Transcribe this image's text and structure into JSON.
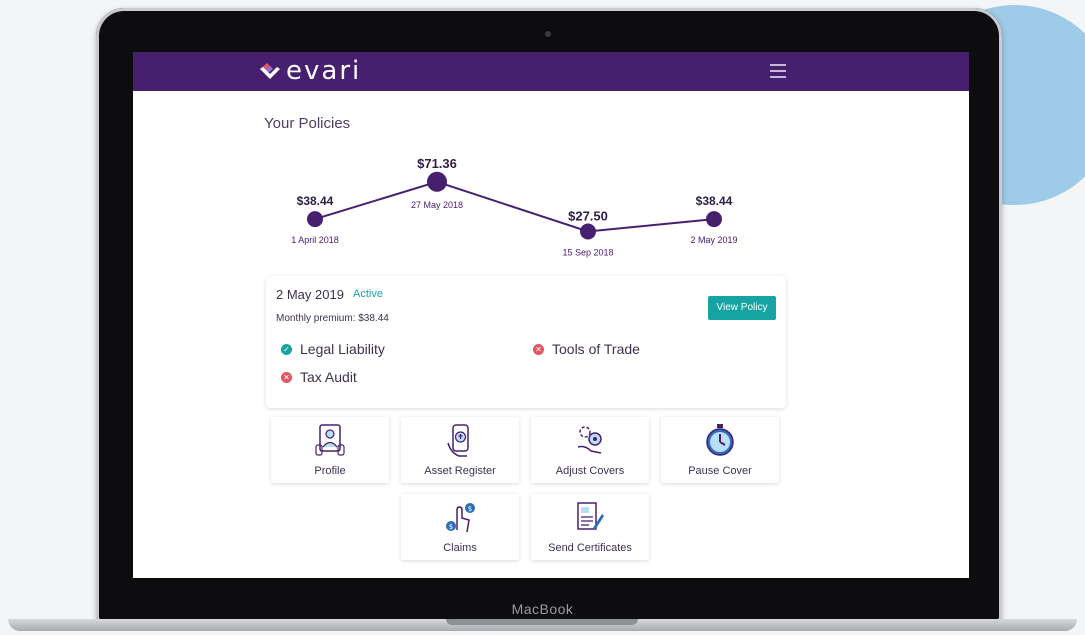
{
  "device": {
    "label": "MacBook"
  },
  "app": {
    "logo_text": "evari"
  },
  "page": {
    "title": "Your Policies"
  },
  "chart_data": {
    "type": "line",
    "x": [
      "1 April 2018",
      "27 May 2018",
      "15 Sep 2018",
      "2 May 2019"
    ],
    "values": [
      38.44,
      71.36,
      27.5,
      38.44
    ],
    "value_labels": [
      "$38.44",
      "$71.36",
      "$27.50",
      "$38.44"
    ],
    "title": "",
    "xlabel": "",
    "ylabel": "",
    "grid": false,
    "color": "#46206f"
  },
  "policy": {
    "date": "2 May 2019",
    "status": "Active",
    "premium": "Monthly premium: $38.44",
    "view_button": "View Policy",
    "covers": [
      {
        "label": "Legal Liability",
        "included": true
      },
      {
        "label": "Tools of Trade",
        "included": false
      },
      {
        "label": "Tax Audit",
        "included": false
      }
    ]
  },
  "tiles": [
    {
      "label": "Profile",
      "icon": "profile-icon"
    },
    {
      "label": "Asset Register",
      "icon": "asset-register-icon"
    },
    {
      "label": "Adjust Covers",
      "icon": "adjust-covers-icon"
    },
    {
      "label": "Pause Cover",
      "icon": "stopwatch-icon"
    },
    {
      "label": "Claims",
      "icon": "claims-icon"
    },
    {
      "label": "Send Certificates",
      "icon": "certificate-icon"
    }
  ],
  "colors": {
    "brand": "#46206f",
    "accent": "#16a4a3",
    "negative": "#e25562"
  }
}
